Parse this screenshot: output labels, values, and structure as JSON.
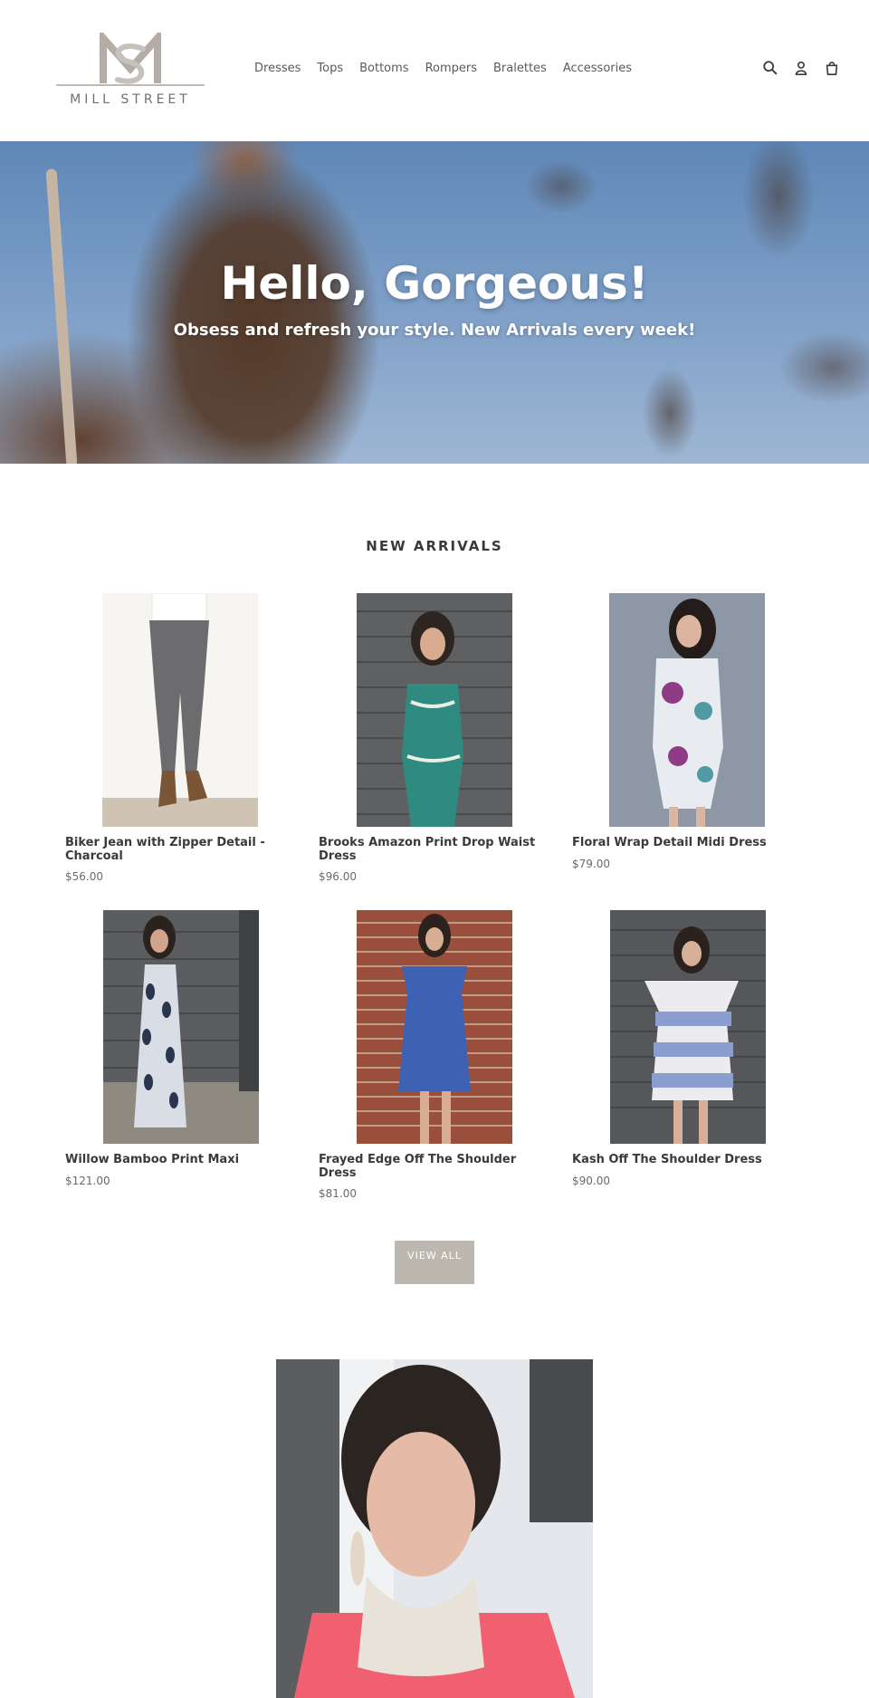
{
  "header": {
    "logo_monogram": "MS",
    "logo_text": "MILL STREET",
    "nav": [
      "Dresses",
      "Tops",
      "Bottoms",
      "Rompers",
      "Bralettes",
      "Accessories"
    ],
    "icons": [
      "search-icon",
      "account-icon",
      "cart-icon"
    ]
  },
  "hero": {
    "title": "Hello, Gorgeous!",
    "subtitle": "Obsess and refresh your style. New Arrivals every week!"
  },
  "new_arrivals": {
    "title": "NEW ARRIVALS",
    "products": [
      {
        "title": "Biker Jean with Zipper Detail - Charcoal",
        "price": "$56.00"
      },
      {
        "title": "Brooks Amazon Print Drop Waist Dress",
        "price": "$96.00"
      },
      {
        "title": "Floral Wrap Detail Midi Dress",
        "price": "$79.00"
      },
      {
        "title": "Willow Bamboo Print Maxi",
        "price": "$121.00"
      },
      {
        "title": "Frayed Edge Off The Shoulder Dress",
        "price": "$81.00"
      },
      {
        "title": "Kash Off The Shoulder Dress",
        "price": "$90.00"
      }
    ],
    "view_all": "VIEW ALL"
  },
  "colors": {
    "text": "#3a3a3a",
    "button_bg": "#bdb8af",
    "logo": "#a9a39c"
  }
}
